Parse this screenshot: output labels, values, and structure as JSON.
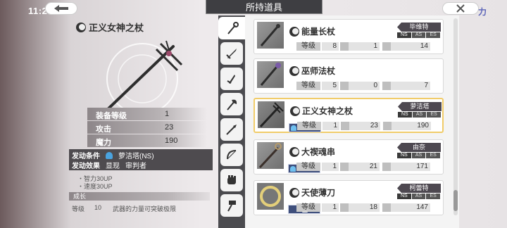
{
  "status": {
    "time": "11:26"
  },
  "header": {
    "title": "所持道具"
  },
  "brand": {
    "mark": "力"
  },
  "detail": {
    "name": "正义女神之杖",
    "stats": [
      {
        "label": "装备等级",
        "value": "1"
      },
      {
        "label": "攻击",
        "value": "23"
      },
      {
        "label": "魔力",
        "value": "190"
      }
    ],
    "condition_label": "发动条件",
    "condition_value": "萝洁塔(NS)",
    "effect_label": "发动效果",
    "effect_value_1": "显现",
    "effect_value_2": "审判者",
    "bonus_1": "・智力30UP",
    "bonus_2": "・速度30UP",
    "growth_label": "成长",
    "growth_level_label": "等级",
    "growth_level": "10",
    "growth_text": "武器的力量可突破极限"
  },
  "tabs": [
    "staff-tab",
    "sword-tab",
    "dagger-tab",
    "axe-tab",
    "spear-tab",
    "bow-tab",
    "fist-tab",
    "hammer-tab"
  ],
  "items": [
    {
      "name": "能量长杖",
      "owner": "毕维特",
      "ns": [
        "NS",
        "AS",
        "ES"
      ],
      "level_label": "等级",
      "level": "8",
      "atk": "1",
      "mag": "14",
      "lv_badge": ""
    },
    {
      "name": "巫师法杖",
      "owner": "",
      "ns": [],
      "level_label": "等级",
      "level": "5",
      "atk": "0",
      "mag": "7",
      "lv_badge": ""
    },
    {
      "name": "正义女神之杖",
      "owner": "萝洁塔",
      "ns": [
        "NS",
        "AS",
        "ES"
      ],
      "level_label": "等级",
      "level": "1",
      "atk": "23",
      "mag": "190",
      "lv_badge": "Lv10"
    },
    {
      "name": "大禊魂串",
      "owner": "由奈",
      "ns": [
        "NS",
        "AS",
        "ES"
      ],
      "level_label": "等级",
      "level": "1",
      "atk": "21",
      "mag": "171",
      "lv_badge": "Lv9"
    },
    {
      "name": "天使薄刀",
      "owner": "柯蕾特",
      "ns": [
        "NS",
        "AS",
        "ES"
      ],
      "level_label": "等级",
      "level": "1",
      "atk": "18",
      "mag": "147",
      "lv_badge": ""
    }
  ],
  "colors": {
    "selected_border": "#f1cc69",
    "panel_dark": "#4b4b4f",
    "badge_blue": "#3f4f7c"
  }
}
